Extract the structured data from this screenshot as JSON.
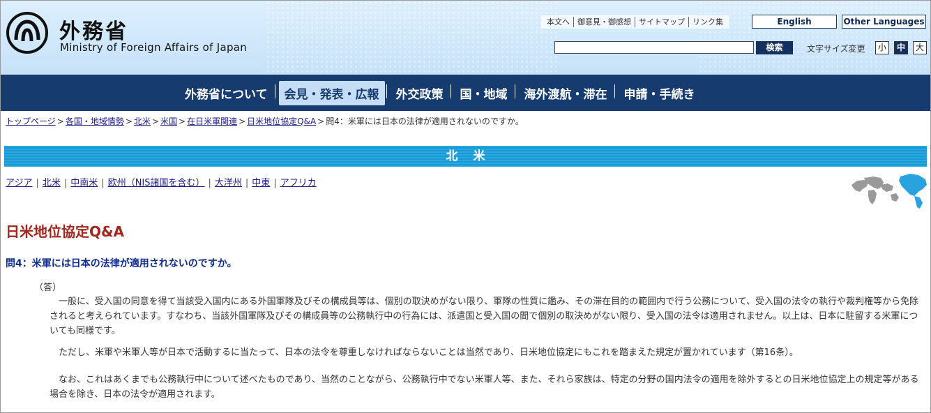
{
  "header": {
    "title_jp": "外務省",
    "title_en": "Ministry of Foreign Affairs of Japan",
    "util_links": [
      "本文へ",
      "御意見・御感想",
      "サイトマップ",
      "リンク集"
    ],
    "lang_english": "English",
    "lang_other": "Other Languages",
    "search_placeholder": "",
    "search_button": "検索",
    "font_size_label": "文字サイズ変更",
    "font_sizes": [
      "小",
      "中",
      "大"
    ]
  },
  "nav": {
    "items": [
      "外務省について",
      "会見・発表・広報",
      "外交政策",
      "国・地域",
      "海外渡航・滞在",
      "申請・手続き"
    ],
    "active_index": 1
  },
  "breadcrumb": {
    "links": [
      "トップページ",
      "各国・地域情勢",
      "北米",
      "米国",
      "在日米軍関連",
      "日米地位協定Q&A"
    ],
    "current": "問4：米軍には日本の法律が適用されないのですか。"
  },
  "region": {
    "band_title": "北米",
    "links": [
      "アジア",
      "北米",
      "中南米",
      "欧州（NIS諸国を含む）",
      "大洋州",
      "中東",
      "アフリカ"
    ]
  },
  "content": {
    "page_title": "日米地位協定Q&A",
    "question": "問4：米軍には日本の法律が適用されないのですか。",
    "answer_label": "（答）",
    "paragraphs": [
      "一般に、受入国の同意を得て当該受入国内にある外国軍隊及びその構成員等は、個別の取決めがない限り、軍隊の性質に鑑み、その滞在目的の範囲内で行う公務について、受入国の法令の執行や裁判権等から免除されると考えられています。すなわち、当該外国軍隊及びその構成員等の公務執行中の行為には、派遣国と受入国の間で個別の取決めがない限り、受入国の法令は適用されません。以上は、日本に駐留する米軍についても同様です。",
      "ただし、米軍や米軍人等が日本で活動するに当たって、日本の法令を尊重しなければならないことは当然であり、日米地位協定にもこれを踏まえた規定が置かれています（第16条）。",
      "なお、これはあくまでも公務執行中について述べたものであり、当然のことながら、公務執行中でない米軍人等、また、それら家族は、特定の分野の国内法令の適用を除外するとの日米地位協定上の規定等がある場合を除き、日本の法令が適用されます。"
    ]
  },
  "colors": {
    "nav_bg": "#163b6e",
    "band": "#1a98d3",
    "title_red": "#a3261e",
    "question_blue": "#0e2d8c",
    "link": "#1a1a8a"
  }
}
